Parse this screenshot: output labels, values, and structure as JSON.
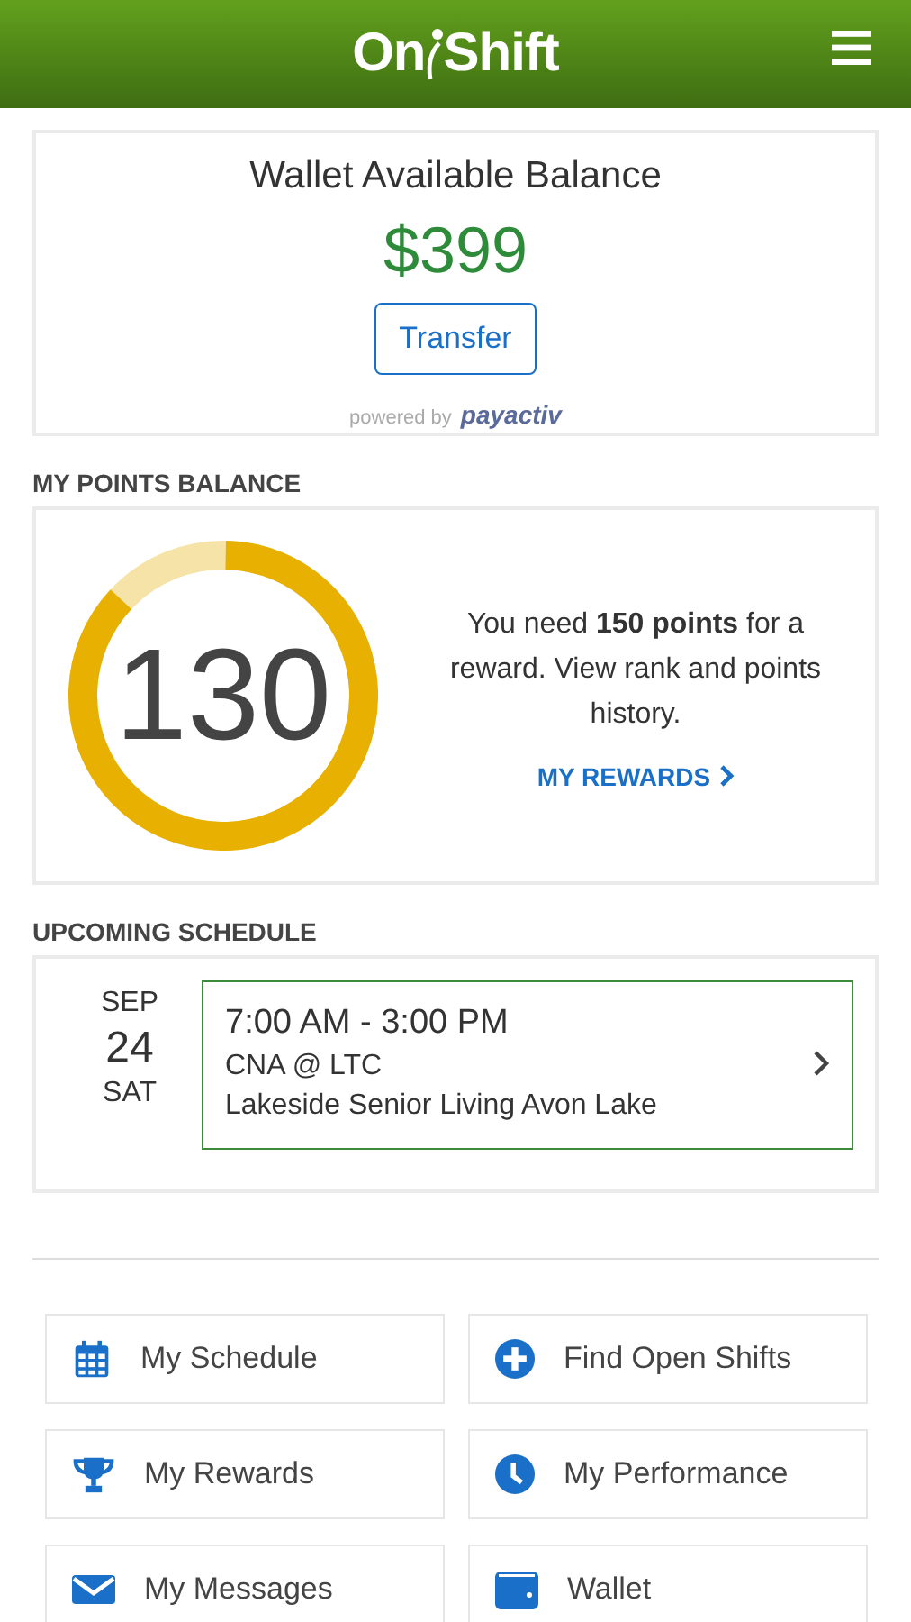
{
  "header": {
    "logo": [
      "On",
      "Shift"
    ]
  },
  "wallet": {
    "title": "Wallet Available Balance",
    "balance": "$399",
    "button": "Transfer",
    "powered_by": "powered by",
    "provider": "payactiv"
  },
  "points": {
    "heading": "MY POINTS BALANCE",
    "value": "130",
    "text": "You need **150 points** for a reward. View rank and points history.",
    "link": "MY REWARDS"
  },
  "schedule": {
    "heading": "UPCOMING SCHEDULE",
    "shifts": [
      {
        "month": "SEP",
        "day": "24",
        "weekday": "SAT",
        "time": "7:00 AM - 3:00 PM",
        "role": "CNA @ LTC",
        "location": "Lakeside Senior Living Avon Lake"
      }
    ]
  },
  "menu": [
    {
      "label": "My Schedule"
    },
    {
      "label": "Find Open Shifts"
    },
    {
      "label": "My Rewards"
    },
    {
      "label": "My Performance"
    },
    {
      "label": "My Messages"
    },
    {
      "label": "Wallet"
    }
  ]
}
